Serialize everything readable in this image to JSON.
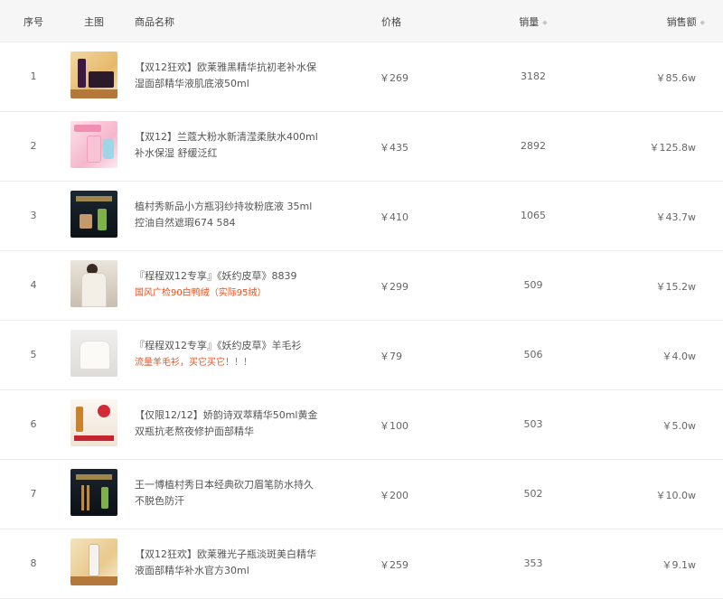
{
  "header": {
    "index": "序号",
    "image": "主图",
    "name": "商品名称",
    "price": "价格",
    "sales": "销量",
    "revenue": "销售额"
  },
  "rows": [
    {
      "index": "1",
      "name": "【双12狂欢】欧莱雅黑精华抗初老补水保湿面部精华液肌底液50ml",
      "note": "",
      "price": "￥269",
      "sales": "3182",
      "revenue": "￥85.6w",
      "thumb": "serum-bottle-gold"
    },
    {
      "index": "2",
      "name": "【双12】兰蔻大粉水新清滢柔肤水400ml 补水保湿 舒缓泛红",
      "note": "",
      "price": "￥435",
      "sales": "2892",
      "revenue": "￥125.8w",
      "thumb": "pink-toner-bottle"
    },
    {
      "index": "3",
      "name": "植村秀新品小方瓶羽纱持妆粉底液 35ml 控油自然遮瑕674 584",
      "note": "",
      "price": "￥410",
      "sales": "1065",
      "revenue": "￥43.7w",
      "thumb": "foundation-bottle-dark"
    },
    {
      "index": "4",
      "name": "『程程双12专享』《妖约皮草》8839",
      "note": "国风广检90白鸭绒（实际95绒）",
      "price": "￥299",
      "sales": "509",
      "revenue": "￥15.2w",
      "thumb": "down-coat"
    },
    {
      "index": "5",
      "name": "『程程双12专享』《妖约皮草》羊毛衫",
      "note": "流量羊毛衫，买它买它！！！",
      "price": "￥79",
      "sales": "506",
      "revenue": "￥4.0w",
      "thumb": "white-sweater"
    },
    {
      "index": "6",
      "name": "【仅限12/12】娇韵诗双萃精华50ml黄金双瓶抗老熬夜修护面部精华",
      "note": "",
      "price": "￥100",
      "sales": "503",
      "revenue": "￥5.0w",
      "thumb": "serum-set"
    },
    {
      "index": "7",
      "name": "王一博植村秀日本经典砍刀眉笔防水持久不脱色防汗",
      "note": "",
      "price": "￥200",
      "sales": "502",
      "revenue": "￥10.0w",
      "thumb": "eyebrow-pencil-dark"
    },
    {
      "index": "8",
      "name": "【双12狂欢】欧莱雅光子瓶淡斑美白精华液面部精华补水官方30ml",
      "note": "",
      "price": "￥259",
      "sales": "353",
      "revenue": "￥9.1w",
      "thumb": "essence-bottle-gold"
    }
  ],
  "colors": {
    "header_bg": "#f6f6f6",
    "note_text": "#e8511c",
    "row_border": "#ececec"
  },
  "icons": {
    "sort": "sort-caret-icon"
  }
}
